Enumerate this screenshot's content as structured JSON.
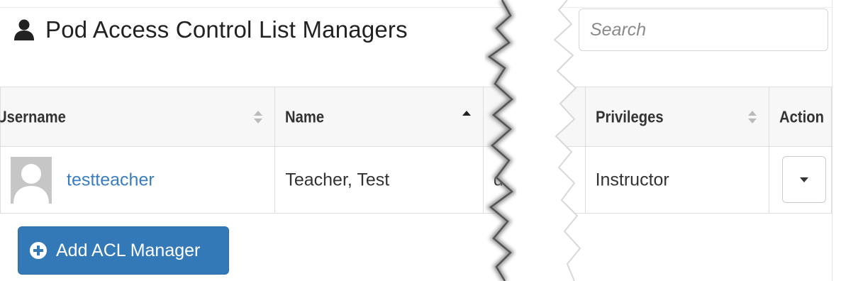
{
  "header": {
    "title": "Pod Access Control List Managers",
    "icon": "user-icon"
  },
  "search": {
    "placeholder": "Search",
    "value": ""
  },
  "table": {
    "columns": [
      {
        "label": "Username",
        "sort": "both"
      },
      {
        "label": "Name",
        "sort": "asc"
      },
      {
        "label": "",
        "sort": "none"
      },
      {
        "label": "Privileges",
        "sort": "both"
      },
      {
        "label": "Action",
        "sort": "none"
      }
    ],
    "rows": [
      {
        "username": "testteacher",
        "name": "Teacher, Test",
        "email_fragment": "d",
        "privileges": "Instructor"
      }
    ]
  },
  "add_button": {
    "label": "Add ACL Manager",
    "icon": "plus-circle-icon"
  },
  "colors": {
    "link": "#3a7ebf",
    "primary_button": "#3379b7",
    "header_bg": "#f7f7f7",
    "border": "#dddddd"
  }
}
